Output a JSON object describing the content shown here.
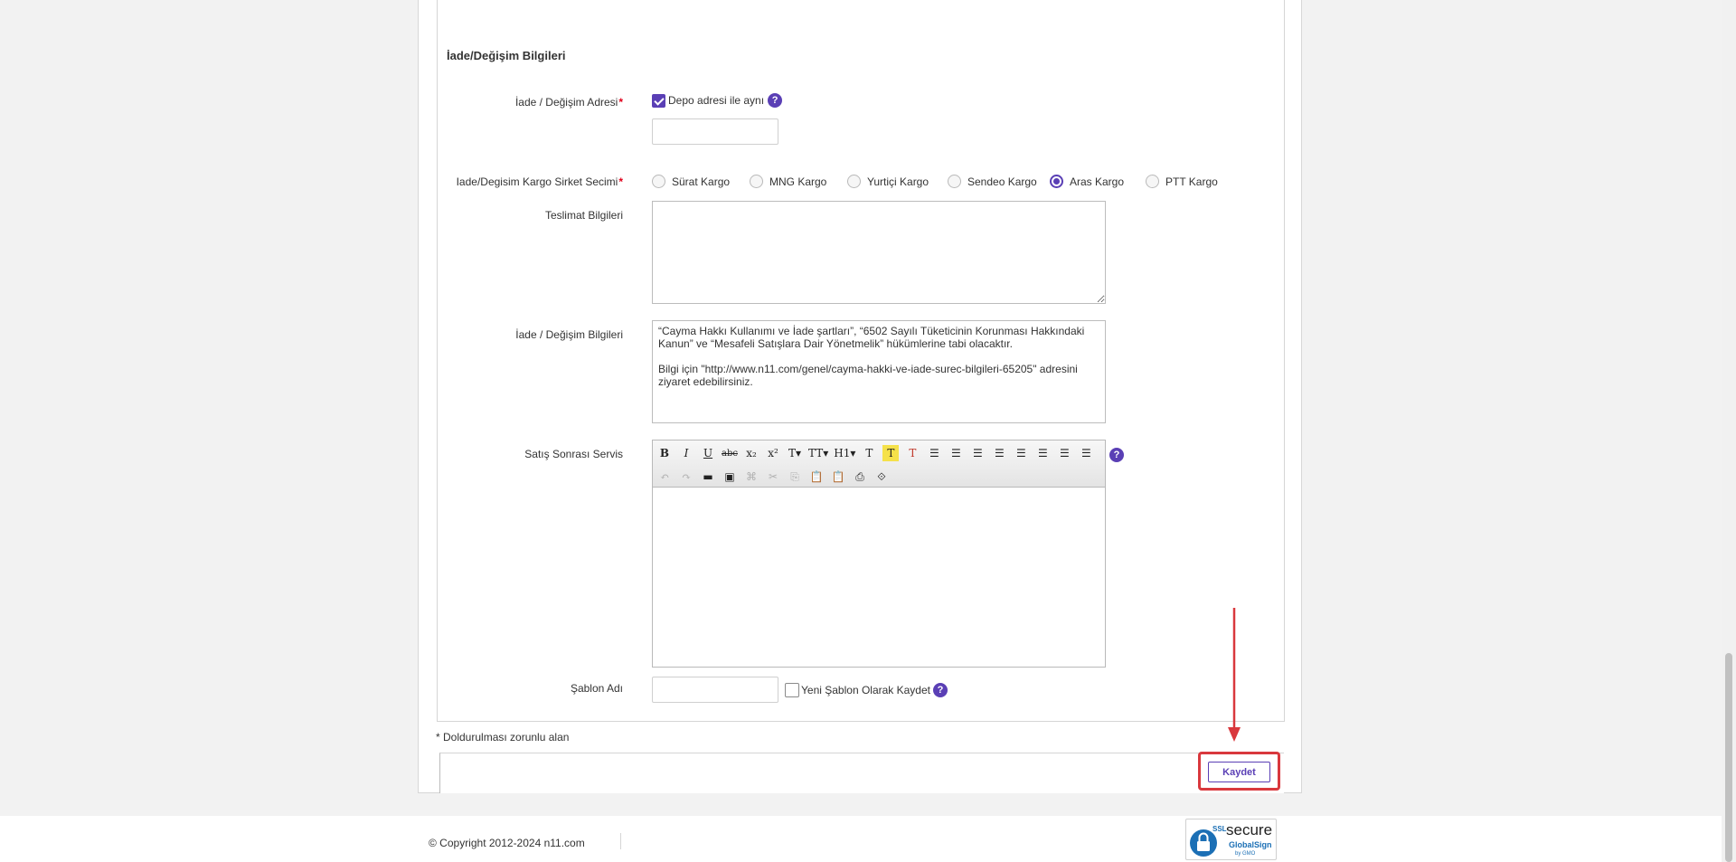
{
  "section": {
    "title": "İade/Değişim Bilgileri"
  },
  "return_address": {
    "label": "İade / Değişim Adresi",
    "required_mark": "*",
    "same_as_warehouse_label": "Depo adresi ile aynı",
    "same_as_warehouse_checked": true,
    "help_symbol": "?",
    "input_value": ""
  },
  "cargo": {
    "label": "Iade/Degisim Kargo Sirket Secimi",
    "required_mark": "*",
    "options": [
      {
        "label": "Sürat Kargo",
        "selected": false
      },
      {
        "label": "MNG Kargo",
        "selected": false
      },
      {
        "label": "Yurtiçi Kargo",
        "selected": false
      },
      {
        "label": "Sendeo Kargo",
        "selected": false
      },
      {
        "label": "Aras Kargo",
        "selected": true
      },
      {
        "label": "PTT Kargo",
        "selected": false
      }
    ]
  },
  "delivery_info": {
    "label": "Teslimat Bilgileri",
    "value": ""
  },
  "return_info": {
    "label": "İade / Değişim Bilgileri",
    "paragraph1": "“Cayma Hakkı Kullanımı ve İade şartları”, “6502 Sayılı Tüketicinin Korunması Hakkındaki Kanun” ve “Mesafeli Satışlara Dair Yönetmelik” hükümlerine tabi olacaktır.",
    "paragraph2": "Bilgi için \"http://www.n11.com/genel/cayma-hakki-ve-iade-surec-bilgileri-65205\" adresini ziyaret edebilirsiniz."
  },
  "after_sales": {
    "label": "Satış Sonrası Servis",
    "help_symbol": "?",
    "toolbar_row1": [
      {
        "name": "bold-button",
        "glyph": "B"
      },
      {
        "name": "italic-button",
        "glyph": "I"
      },
      {
        "name": "underline-button",
        "glyph": "U"
      },
      {
        "name": "strikethrough-button",
        "glyph": "abc"
      },
      {
        "name": "subscript-button",
        "glyph": "x₂"
      },
      {
        "name": "superscript-button",
        "glyph": "x²"
      },
      {
        "name": "font-family-button",
        "glyph": "T▾"
      },
      {
        "name": "font-size-button",
        "glyph": "TT▾"
      },
      {
        "name": "heading-button",
        "glyph": "H1▾"
      },
      {
        "name": "text-color-button",
        "glyph": "T"
      },
      {
        "name": "highlight-button",
        "glyph": "T"
      },
      {
        "name": "clear-format-button",
        "glyph": "T"
      },
      {
        "name": "bullet-list-button",
        "glyph": "☰"
      },
      {
        "name": "numbered-list-button",
        "glyph": "☰"
      },
      {
        "name": "outdent-button",
        "glyph": "☰"
      },
      {
        "name": "indent-button",
        "glyph": "☰"
      },
      {
        "name": "align-left-button",
        "glyph": "☰"
      },
      {
        "name": "align-center-button",
        "glyph": "☰"
      },
      {
        "name": "align-right-button",
        "glyph": "☰"
      },
      {
        "name": "justify-button",
        "glyph": "☰"
      }
    ],
    "toolbar_row2": [
      {
        "name": "undo-button",
        "glyph": "↶",
        "dim": true
      },
      {
        "name": "redo-button",
        "glyph": "↷",
        "dim": true
      },
      {
        "name": "horizontal-rule-button",
        "glyph": "▬",
        "dim": false
      },
      {
        "name": "insert-image-button",
        "glyph": "▣",
        "dim": false
      },
      {
        "name": "insert-link-button",
        "glyph": "⌘",
        "dim": true
      },
      {
        "name": "cut-button",
        "glyph": "✂",
        "dim": true
      },
      {
        "name": "copy-button",
        "glyph": "⎘",
        "dim": true
      },
      {
        "name": "paste-button",
        "glyph": "📋",
        "dim": true
      },
      {
        "name": "paste-text-button",
        "glyph": "📋",
        "dim": false
      },
      {
        "name": "print-button",
        "glyph": "⎙",
        "dim": false
      },
      {
        "name": "source-button",
        "glyph": "⟐",
        "dim": false
      }
    ]
  },
  "template_name": {
    "label": "Şablon Adı",
    "input_value": "",
    "save_as_new_label": "Yeni Şablon Olarak Kaydet",
    "save_as_new_checked": false,
    "help_symbol": "?"
  },
  "required_note": "* Doldurulması zorunlu alan",
  "save_button": "Kaydet",
  "footer": {
    "copyright": "© Copyright 2012-2024 n11.com",
    "ssl_line1": "SSL",
    "ssl_secure": "secure",
    "ssl_brand": "GlobalSign",
    "ssl_by": "by GMO"
  },
  "colors": {
    "accent": "#5a3fb5",
    "required": "#e0001a",
    "highlight_box": "#d9383d"
  }
}
